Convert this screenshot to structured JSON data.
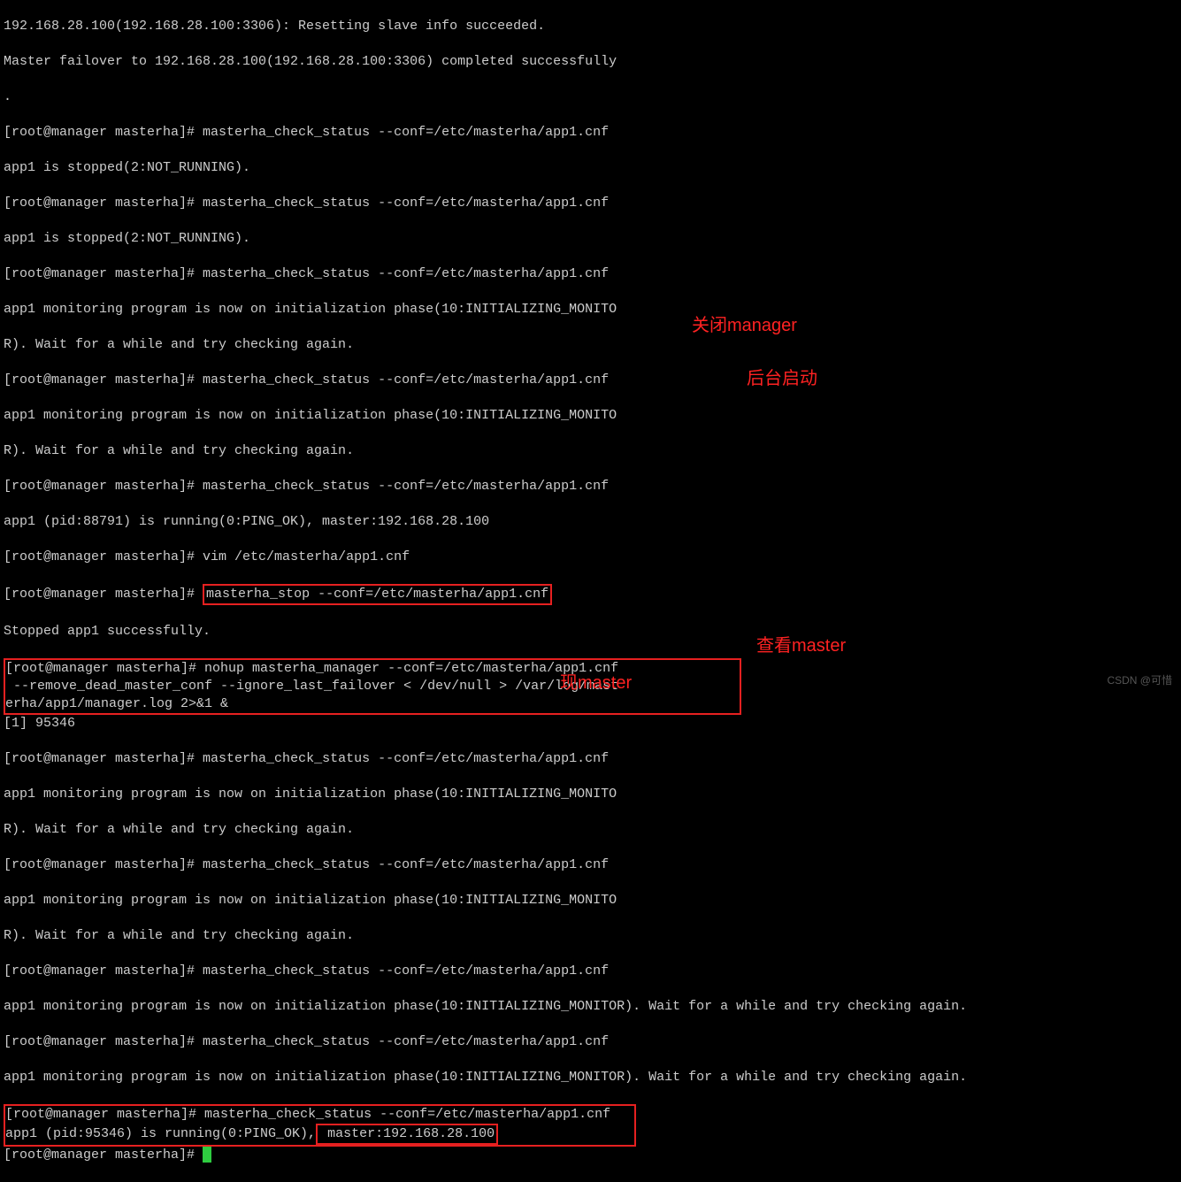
{
  "lines": {
    "l1": "192.168.28.100(192.168.28.100:3306): Resetting slave info succeeded.",
    "l2": "Master failover to 192.168.28.100(192.168.28.100:3306) completed successfully",
    "l3": ".",
    "l4_prompt": "[root@manager masterha]# ",
    "l4_cmd": "masterha_check_status --conf=/etc/masterha/app1.cnf",
    "l5": "app1 is stopped(2:NOT_RUNNING).",
    "l6_cmd": "masterha_check_status --conf=/etc/masterha/app1.cnf",
    "l7": "app1 is stopped(2:NOT_RUNNING).",
    "l8_cmd": "masterha_check_status --conf=/etc/masterha/app1.cnf",
    "l9": "app1 monitoring program is now on initialization phase(10:INITIALIZING_MONITO",
    "l10": "R). Wait for a while and try checking again.",
    "l11_cmd": "masterha_check_status --conf=/etc/masterha/app1.cnf",
    "l12": "app1 monitoring program is now on initialization phase(10:INITIALIZING_MONITO",
    "l13": "R). Wait for a while and try checking again.",
    "l14_cmd": "masterha_check_status --conf=/etc/masterha/app1.cnf",
    "l15": "app1 (pid:88791) is running(0:PING_OK), master:192.168.28.100",
    "l16_cmd": "vim /etc/masterha/app1.cnf",
    "l17_cmd": "masterha_stop --conf=/etc/masterha/app1.cnf",
    "l18": "Stopped app1 successfully.",
    "l19a": "[root@manager masterha]# nohup masterha_manager --conf=/etc/masterha/app1.cnf",
    "l19b": " --remove_dead_master_conf --ignore_last_failover < /dev/null > /var/log/mast",
    "l19c": "erha/app1/manager.log 2>&1 &",
    "l20": "[1] 95346",
    "l21_cmd": "masterha_check_status --conf=/etc/masterha/app1.cnf",
    "l22": "app1 monitoring program is now on initialization phase(10:INITIALIZING_MONITO",
    "l23": "R). Wait for a while and try checking again.",
    "l24_cmd": "masterha_check_status --conf=/etc/masterha/app1.cnf",
    "l25": "app1 monitoring program is now on initialization phase(10:INITIALIZING_MONITO",
    "l26": "R). Wait for a while and try checking again.",
    "l27_cmd": "masterha_check_status --conf=/etc/masterha/app1.cnf",
    "l28": "app1 monitoring program is now on initialization phase(10:INITIALIZING_MONITOR). Wait for a while and try checking again.",
    "l29_cmd": "masterha_check_status --conf=/etc/masterha/app1.cnf",
    "l30": "app1 monitoring program is now on initialization phase(10:INITIALIZING_MONITOR). Wait for a while and try checking again.",
    "l31_cmd": "masterha_check_status --conf=/etc/masterha/app1.cnf",
    "l32a": "app1 (pid:95346) is running(0:PING_OK),",
    "l32b": " master:192.168.28.100"
  },
  "annotations": {
    "close_manager": "关闭manager",
    "bg_start": "后台启动",
    "view_master": "查看master",
    "current_master": "现master"
  },
  "watermark": "CSDN @可惜"
}
